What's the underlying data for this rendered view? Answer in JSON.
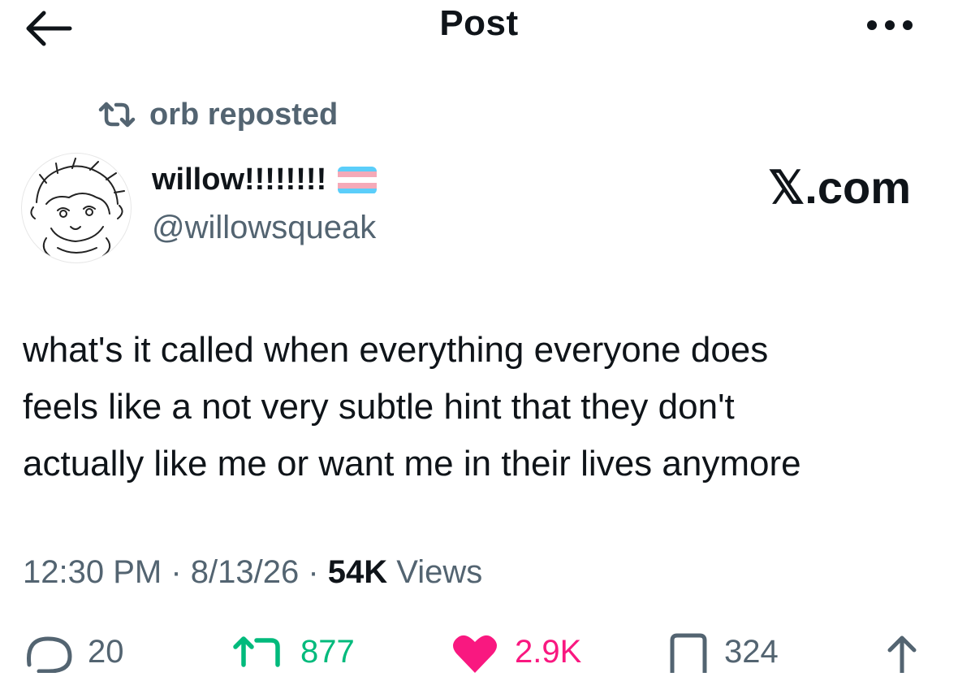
{
  "header": {
    "title": "Post"
  },
  "repost": {
    "label": "orb reposted"
  },
  "author": {
    "display_name": "willow!!!!!!!!",
    "handle": "@willowsqueak",
    "flag_colors": [
      "#5BCEFA",
      "#F5A9B8",
      "#FFFFFF",
      "#F5A9B8",
      "#5BCEFA"
    ]
  },
  "watermark": "𝕏.com",
  "post": {
    "lines": [
      "what's it called when everything everyone does",
      "feels like a not very subtle hint that they don't",
      "actually like me or want me in their lives anymore"
    ]
  },
  "meta": {
    "time": "12:30 PM",
    "sep1": " · ",
    "date": "8/13/26",
    "sep2": " · ",
    "views": "54K",
    "views_label": " Views"
  },
  "actions": {
    "replies": "20",
    "reposts": "877",
    "likes": "2.9K",
    "bookmarks": "324"
  },
  "colors": {
    "repost": "#00ba7c",
    "like": "#f91880",
    "muted": "#536471",
    "text": "#0f1419"
  }
}
